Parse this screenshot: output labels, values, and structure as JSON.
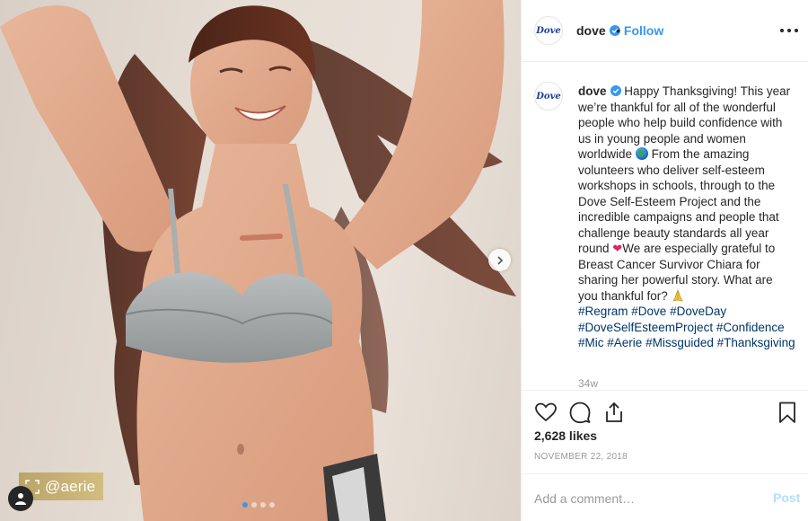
{
  "photo": {
    "watermark_handle": "@aerie",
    "carousel": {
      "count": 4,
      "active_index": 0
    },
    "icons": {
      "next": "chevron-right-icon",
      "tag": "user-tag-icon",
      "watermark": "repost-frame-icon"
    }
  },
  "header": {
    "avatar_logo": "Dove",
    "username": "dove",
    "separator": "•",
    "follow_label": "Follow",
    "verified": true,
    "more_icon": "more-options-icon"
  },
  "caption": {
    "avatar_logo": "Dove",
    "username": "dove",
    "text_1": "Happy Thanksgiving! This year we’re thankful for all of the wonderful people who help build confidence with us in young people and women worldwide",
    "text_2": "From the amazing volunteers who deliver self-esteem workshops in schools, through to the Dove Self-Esteem Project and the incredible campaigns and people that challenge beauty standards all year round",
    "text_3": "We are especially grateful to Breast Cancer Survivor Chiara for sharing her powerful story. What are you thankful for?",
    "hashtags": [
      "#Regram",
      "#Dove",
      "#DoveDay",
      "#DoveSelfEsteemProject",
      "#Confidence",
      "#Mic",
      "#Aerie",
      "#Missguided",
      "#Thanksgiving"
    ],
    "time_ago": "34w"
  },
  "actions": {
    "icons": [
      "heart-icon",
      "comment-icon",
      "share-icon",
      "bookmark-icon"
    ],
    "likes": "2,628 likes",
    "date": "NOVEMBER 22, 2018"
  },
  "comment_box": {
    "placeholder": "Add a comment…",
    "post_label": "Post"
  },
  "colors": {
    "link_blue": "#3897f0",
    "hashtag": "#003569",
    "muted": "#999999",
    "border": "#efefef",
    "watermark_gold": "#c7b073"
  }
}
